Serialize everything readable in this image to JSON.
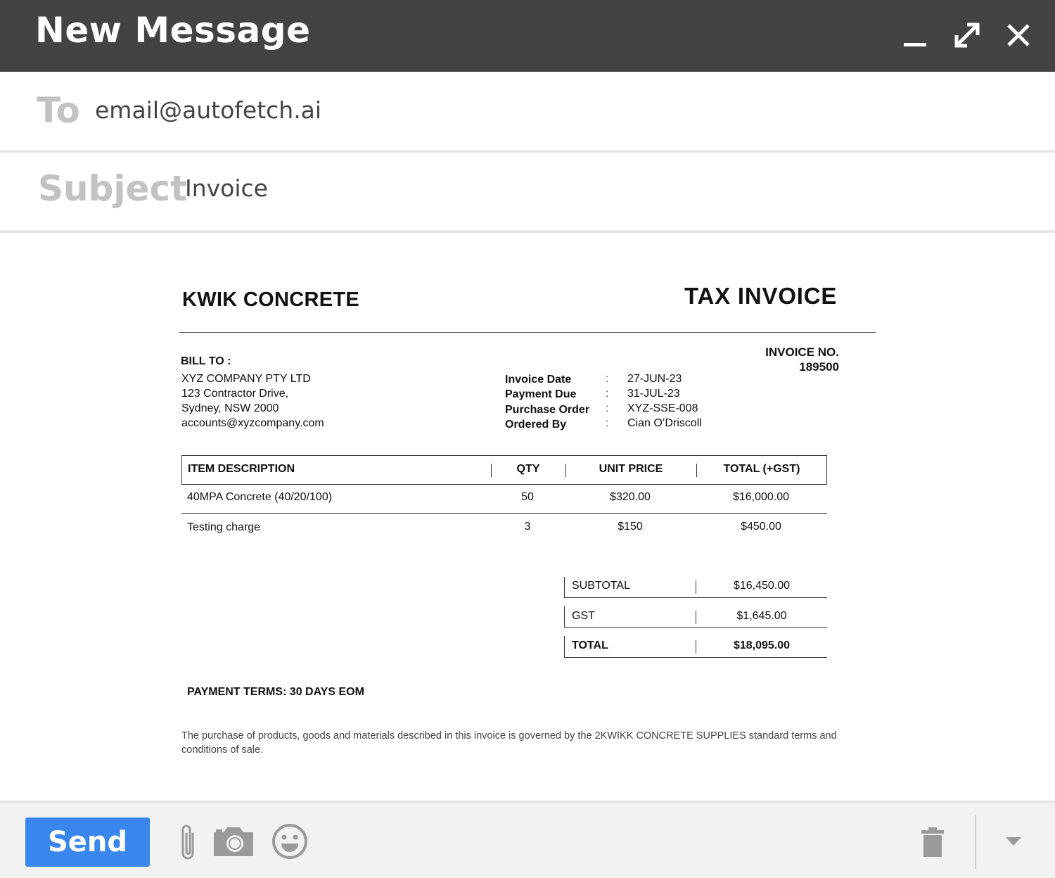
{
  "window": {
    "title": "New Message",
    "icons": [
      "minimize-icon",
      "expand-icon",
      "close-icon"
    ]
  },
  "to": {
    "label": "To",
    "value": "email@autofetch.ai"
  },
  "subject": {
    "label": "Subject",
    "value": "Invoice"
  },
  "invoice": {
    "company": "KWIK CONCRETE",
    "doc_title": "TAX INVOICE",
    "invoice_no_label": "INVOICE NO.",
    "invoice_no": "189500",
    "bill_to_label": "BILL TO :",
    "bill_to": [
      "XYZ COMPANY PTY LTD",
      "123 Contractor Drive,",
      "Sydney, NSW 2000",
      "accounts@xyzcompany.com"
    ],
    "meta": [
      {
        "label": "Invoice Date",
        "sep": ":",
        "value": "27-JUN-23"
      },
      {
        "label": "Payment Due",
        "sep": ":",
        "value": "31-JUL-23"
      },
      {
        "label": "Purchase Order",
        "sep": ":",
        "value": "XYZ-SSE-008"
      },
      {
        "label": "Ordered By",
        "sep": ":",
        "value": "Cian O’Driscoll"
      }
    ],
    "columns": [
      "ITEM DESCRIPTION",
      "QTY",
      "UNIT PRICE",
      "TOTAL (+GST)"
    ],
    "rows": [
      {
        "description": "40MPA Concrete (40/20/100)",
        "qty": "50",
        "unit_price": "$320.00",
        "total": "$16,000.00"
      },
      {
        "description": "Testing charge",
        "qty": "3",
        "unit_price": "$150",
        "total": "$450.00"
      }
    ],
    "totals": [
      {
        "label": "SUBTOTAL",
        "value": "$16,450.00"
      },
      {
        "label": "GST",
        "value": "$1,645.00"
      },
      {
        "label": "TOTAL",
        "value": "$18,095.00"
      }
    ],
    "payment_terms": "PAYMENT TERMS: 30 DAYS EOM",
    "legal": "The purchase of products, goods and materials described in this invoice is governed by the 2KWIKK CONCRETE SUPPLIES standard terms and conditions of sale."
  },
  "toolbar": {
    "send_label": "Send",
    "icons": [
      "paperclip-icon",
      "camera-icon",
      "emoji-icon",
      "trash-icon",
      "more-options-icon"
    ],
    "colors": {
      "send": "#3a86ef",
      "titlebar": "#434343"
    }
  }
}
